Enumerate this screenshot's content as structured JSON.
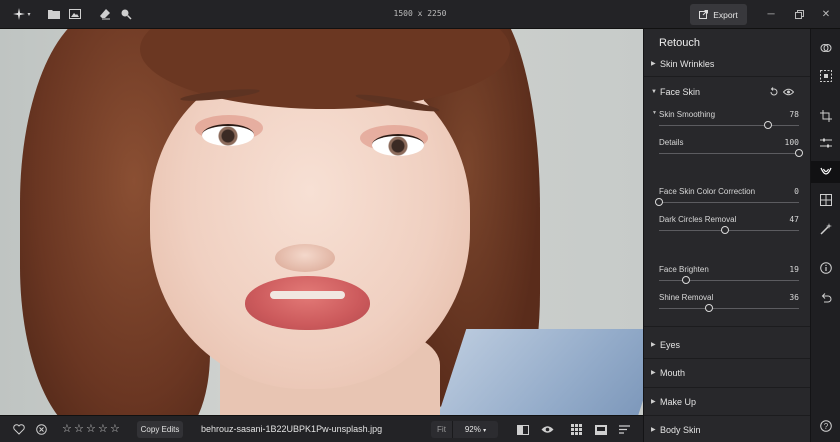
{
  "topbar": {
    "dimensions": "1500 x 2250",
    "export_label": "Export",
    "icons": [
      "logo-icon",
      "folder-icon",
      "image-icon",
      "eraser-icon",
      "search-icon",
      "export-icon",
      "minimize-icon",
      "restore-icon",
      "close-icon"
    ]
  },
  "bottombar": {
    "rating_stars": [
      "☆",
      "☆",
      "☆",
      "☆",
      "☆"
    ],
    "copy_edits": "Copy Edits",
    "filename": "behrouz-sasani-1B22UBPK1Pw-unsplash.jpg",
    "fit": "Fit",
    "zoom": "92%",
    "zoom_chevron": "▾"
  },
  "panel": {
    "title": "Retouch",
    "sections": {
      "skin_wrinkles": "Skin Wrinkles",
      "face_skin": "Face Skin",
      "eyes": "Eyes",
      "mouth": "Mouth",
      "make_up": "Make Up",
      "body_skin": "Body Skin"
    },
    "sliders": [
      {
        "label": "Skin Smoothing",
        "value": "78",
        "fraction": 0.78
      },
      {
        "label": "Details",
        "value": "100",
        "fraction": 1.0
      },
      {
        "label": "Face Skin Color Correction",
        "value": "0",
        "fraction": 0.0
      },
      {
        "label": "Dark Circles Removal",
        "value": "47",
        "fraction": 0.47
      },
      {
        "label": "Face Brighten",
        "value": "19",
        "fraction": 0.19
      },
      {
        "label": "Shine Removal",
        "value": "36",
        "fraction": 0.36
      }
    ]
  }
}
